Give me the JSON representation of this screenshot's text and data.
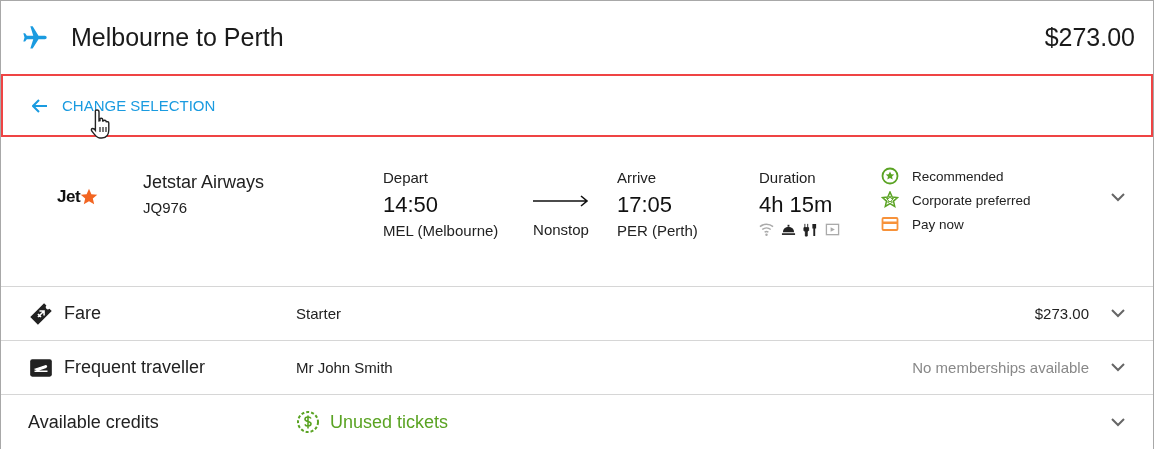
{
  "header": {
    "title": "Melbourne to Perth",
    "price": "$273.00"
  },
  "change_selection": {
    "label": "CHANGE SELECTION",
    "highlighted": true
  },
  "flight": {
    "logo_text": "Jet",
    "airline": "Jetstar Airways",
    "flight_number": "JQ976",
    "depart": {
      "label": "Depart",
      "time": "14:50",
      "airport": "MEL (Melbourne)"
    },
    "stops": "Nonstop",
    "arrive": {
      "label": "Arrive",
      "time": "17:05",
      "airport": "PER (Perth)"
    },
    "duration": {
      "label": "Duration",
      "value": "4h 15m"
    },
    "amenities": [
      {
        "kind": "wifi",
        "available": false
      },
      {
        "kind": "meal",
        "available": true
      },
      {
        "kind": "power",
        "available": true
      },
      {
        "kind": "video",
        "available": false
      }
    ],
    "tags": [
      {
        "kind": "recommended",
        "label": "Recommended"
      },
      {
        "kind": "corporate",
        "label": "Corporate preferred"
      },
      {
        "kind": "paynow",
        "label": "Pay now"
      }
    ],
    "expanded": false
  },
  "rows": [
    {
      "kind": "fare",
      "label": "Fare",
      "value": "Starter",
      "note": "$273.00",
      "note_muted": false,
      "expanded": false
    },
    {
      "kind": "traveller",
      "label": "Frequent traveller",
      "value": "Mr John Smith",
      "note": "No memberships available",
      "note_muted": true,
      "expanded": false
    },
    {
      "kind": "credit",
      "label": "Available credits",
      "value": "Unused tickets",
      "expanded": false
    }
  ]
}
